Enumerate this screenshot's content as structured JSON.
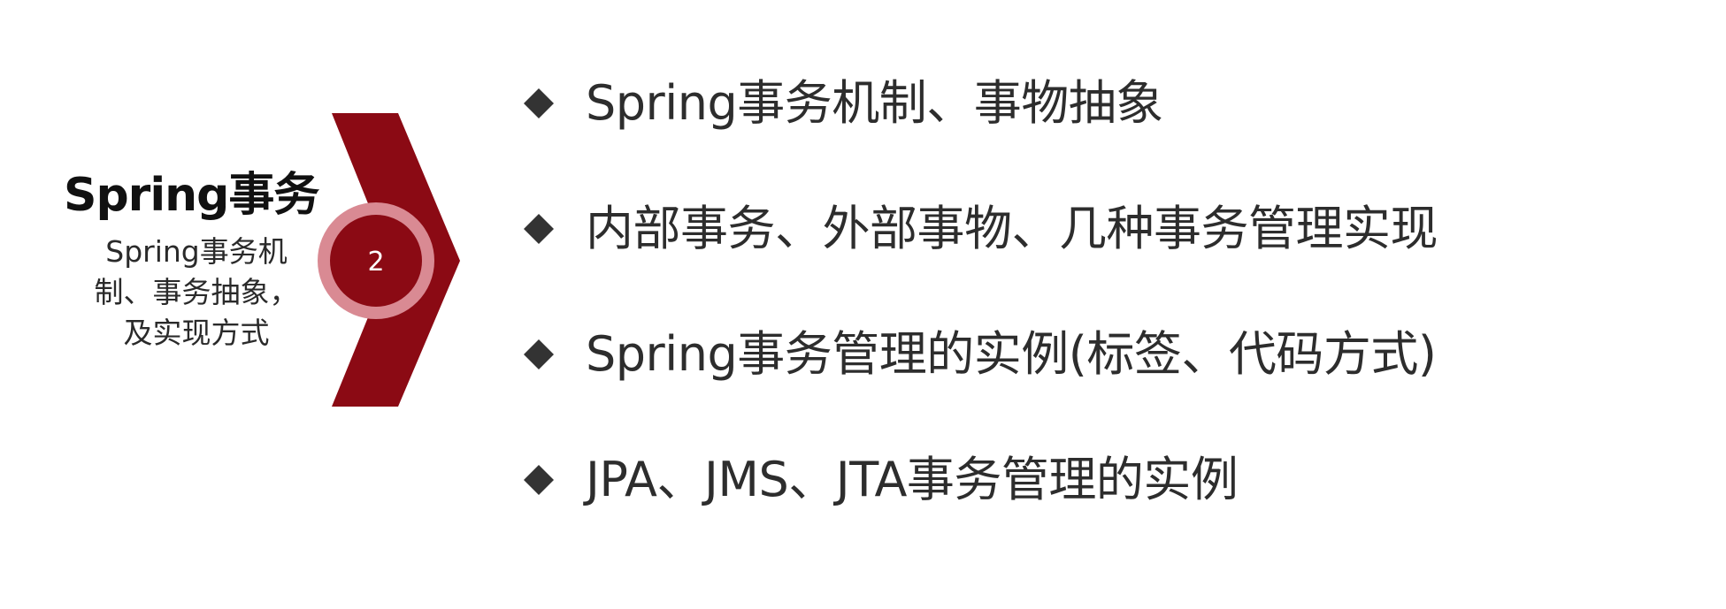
{
  "section": {
    "title": "Spring事务",
    "description": "Spring事务机制、事务抽象，及实现方式",
    "step_number": "2"
  },
  "bullets": [
    {
      "text": "Spring事务机制、事物抽象",
      "icon": "diamond-bullet-icon"
    },
    {
      "text": "内部事务、外部事物、几种事务管理实现",
      "icon": "diamond-bullet-icon"
    },
    {
      "text": "Spring事务管理的实例(标签、代码方式)",
      "icon": "diamond-bullet-icon"
    },
    {
      "text": "JPA、JMS、JTA事务管理的实例",
      "icon": "diamond-bullet-icon"
    }
  ],
  "colors": {
    "chevron": "#8b0a14",
    "badge_ring": "#d98a93",
    "badge_inner": "#8b0a14",
    "bullet": "#333333",
    "text": "#2d2d2d"
  }
}
